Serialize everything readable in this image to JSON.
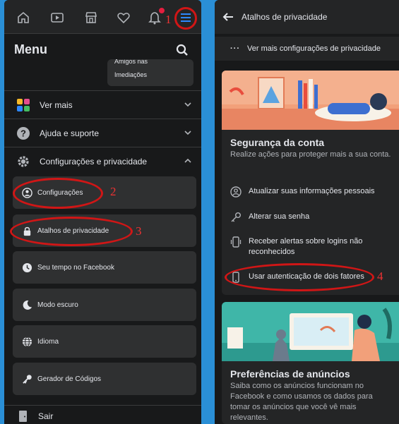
{
  "left": {
    "menu_title": "Menu",
    "card_peek": [
      "Amigos nas",
      "Imediações"
    ],
    "sections": [
      {
        "label": "Ver mais",
        "icon": "grid-colors-icon"
      },
      {
        "label": "Ajuda e suporte",
        "icon": "help-icon"
      },
      {
        "label": "Configurações e privacidade",
        "icon": "gear-icon"
      }
    ],
    "subitems": [
      {
        "label": "Configurações",
        "icon": "user-circle-icon"
      },
      {
        "label": "Atalhos de privacidade",
        "icon": "lock-icon"
      },
      {
        "label": "Seu tempo no Facebook",
        "icon": "clock-icon"
      },
      {
        "label": "Modo escuro",
        "icon": "moon-icon"
      },
      {
        "label": "Idioma",
        "icon": "globe-icon"
      },
      {
        "label": "Gerador de Códigos",
        "icon": "key-icon"
      }
    ],
    "logout": "Sair",
    "callouts": [
      "1",
      "2",
      "3"
    ]
  },
  "right": {
    "header_title": "Atalhos de privacidade",
    "more_link": "Ver mais configurações de privacidade",
    "security_card": {
      "title": "Segurança da conta",
      "description": "Realize ações para proteger mais a sua conta.",
      "options": [
        {
          "label": "Atualizar suas informações pessoais",
          "icon": "id-card-icon"
        },
        {
          "label": "Alterar sua senha",
          "icon": "key-outline-icon"
        },
        {
          "label": "Receber alertas sobre logins não reconhecidos",
          "icon": "phone-alert-icon"
        },
        {
          "label": "Usar autenticação de dois fatores",
          "icon": "phone-icon"
        }
      ]
    },
    "ads_card": {
      "title": "Preferências de anúncios",
      "description": "Saiba como os anúncios funcionam no Facebook e como usamos os dados para tomar os anúncios que você vê mais relevantes."
    },
    "callouts": [
      "4"
    ]
  },
  "colors": {
    "background": "#2a8fd6",
    "panel": "#18191a",
    "surface": "#242526",
    "item": "#2f3031",
    "text": "#e4e6eb",
    "annotation": "#d01616"
  }
}
